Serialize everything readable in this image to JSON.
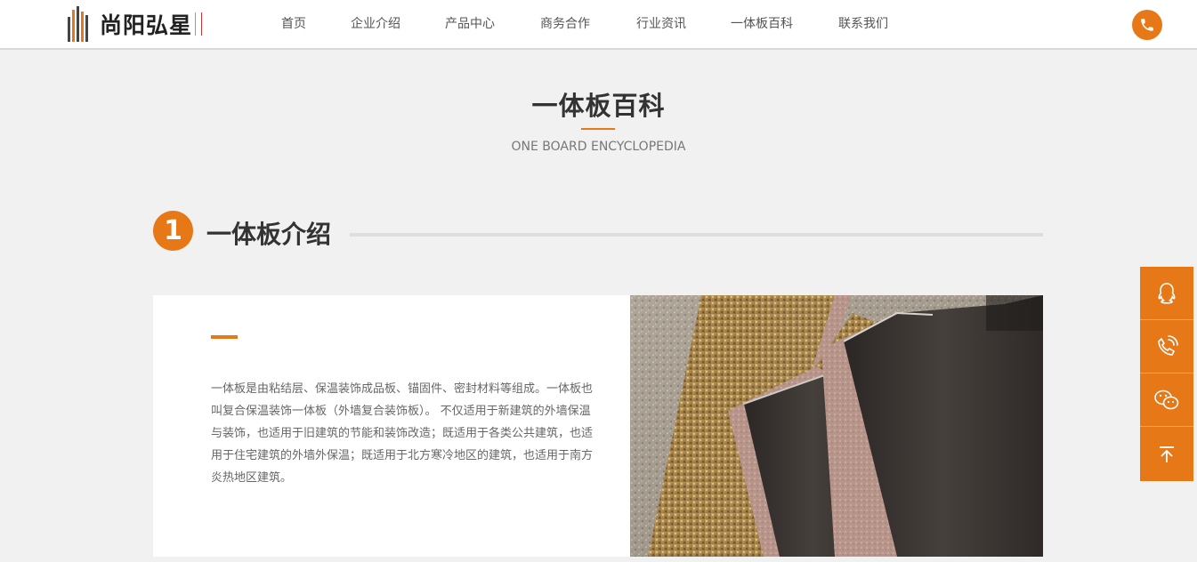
{
  "header": {
    "logo_text": "尚阳弘星",
    "nav": [
      "首页",
      "企业介绍",
      "产品中心",
      "商务合作",
      "行业资讯",
      "一体板百科",
      "联系我们"
    ],
    "phone_icon": "phone-icon"
  },
  "section": {
    "title": "一体板百科",
    "subtitle": "ONE BOARD ENCYCLOPEDIA"
  },
  "intro": {
    "number": "1",
    "heading": "一体板介绍",
    "body": "一体板是由粘结层、保温装饰成品板、锚固件、密封材料等组成。一体板也叫复合保温装饰一体板（外墙复合装饰板）。 不仅适用于新建筑的外墙保温与装饰，也适用于旧建筑的节能和装饰改造；既适用于各类公共建筑，也适用于住宅建筑的外墙外保温；既适用于北方寒冷地区的建筑，也适用于南方炎热地区建筑。",
    "image_icon": "board-sample-photo"
  },
  "side_tools": [
    "qq-icon",
    "phone-icon",
    "wechat-icon",
    "back-to-top-icon"
  ],
  "colors": {
    "accent": "#e67818",
    "background": "#f1f1f1",
    "text": "#333333"
  }
}
